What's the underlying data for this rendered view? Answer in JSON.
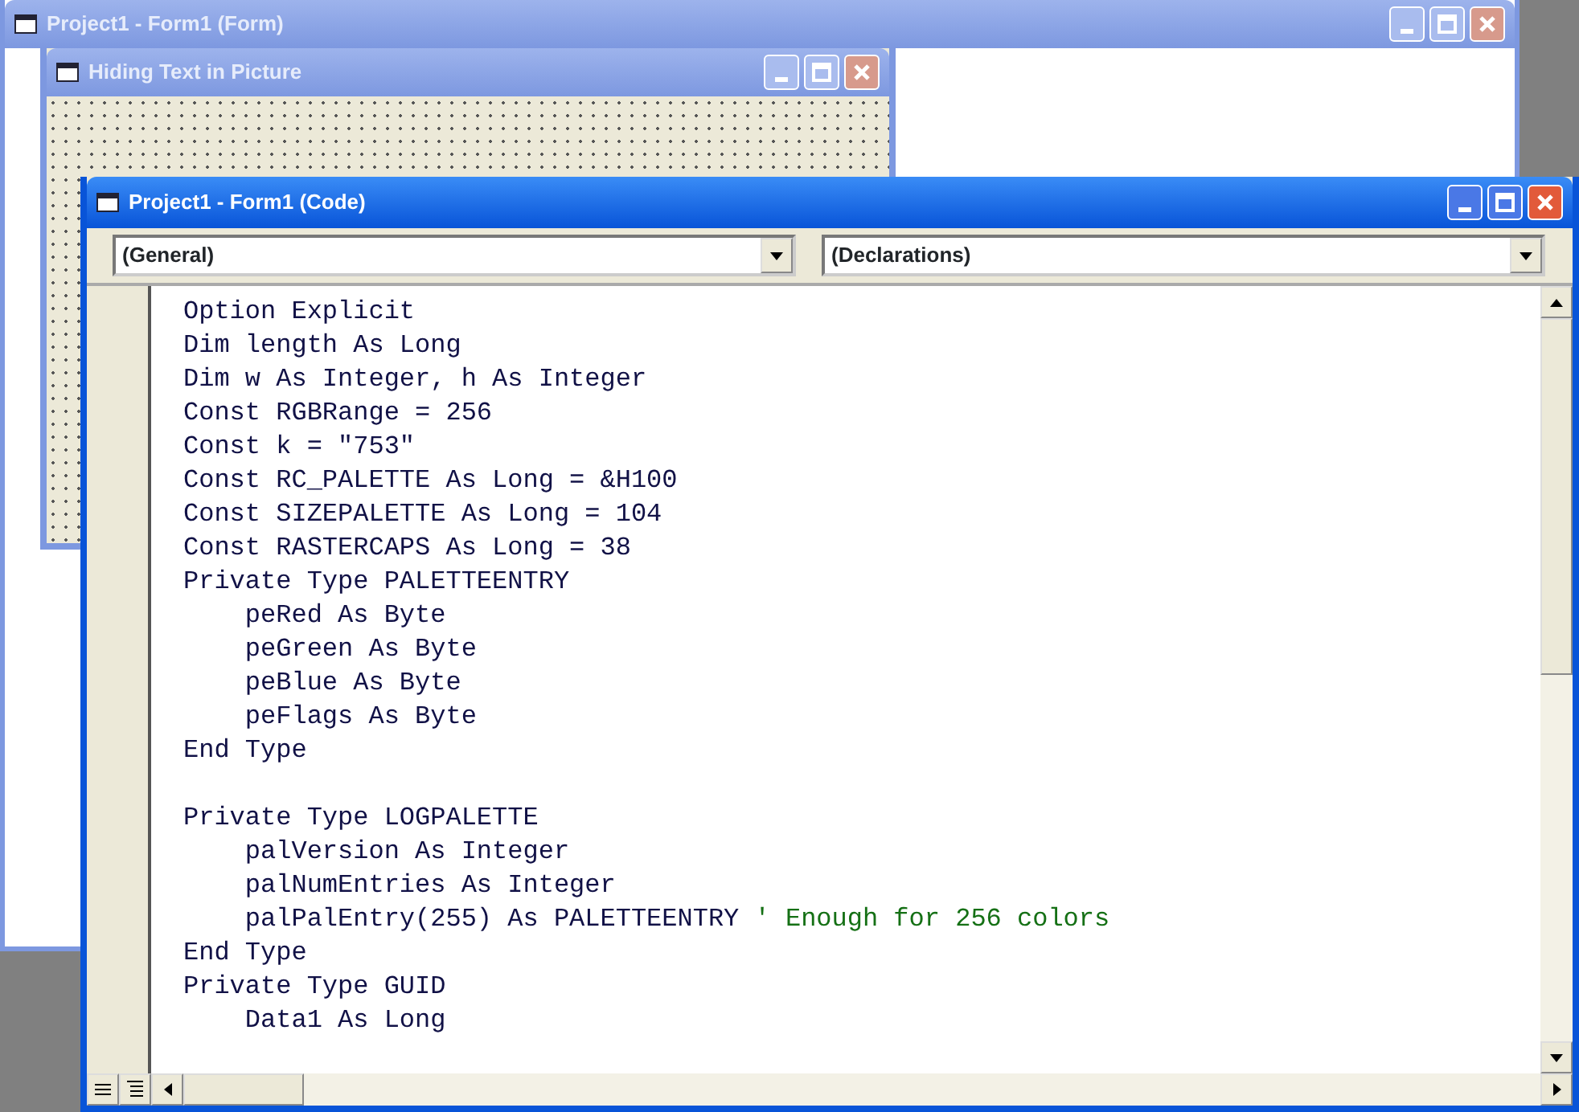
{
  "form_window": {
    "title": "Project1 - Form1 (Form)"
  },
  "designer_window": {
    "title": "Hiding Text in Picture"
  },
  "code_window": {
    "title": "Project1 - Form1 (Code)",
    "object_combo": {
      "value": "(General)"
    },
    "procedure_combo": {
      "value": "(Declarations)"
    },
    "lines": [
      {
        "kind": "code",
        "code": "Option Explicit"
      },
      {
        "kind": "code",
        "code": "Dim length As Long"
      },
      {
        "kind": "code",
        "code": "Dim w As Integer, h As Integer"
      },
      {
        "kind": "code",
        "code": "Const RGBRange = 256"
      },
      {
        "kind": "code",
        "code": "Const k = \"753\""
      },
      {
        "kind": "code",
        "code": "Const RC_PALETTE As Long = &H100"
      },
      {
        "kind": "code",
        "code": "Const SIZEPALETTE As Long = 104"
      },
      {
        "kind": "code",
        "code": "Const RASTERCAPS As Long = 38"
      },
      {
        "kind": "code",
        "code": "Private Type PALETTEENTRY"
      },
      {
        "kind": "code",
        "code": "    peRed As Byte"
      },
      {
        "kind": "code",
        "code": "    peGreen As Byte"
      },
      {
        "kind": "code",
        "code": "    peBlue As Byte"
      },
      {
        "kind": "code",
        "code": "    peFlags As Byte"
      },
      {
        "kind": "code",
        "code": "End Type"
      },
      {
        "kind": "blank"
      },
      {
        "kind": "code",
        "code": "Private Type LOGPALETTE"
      },
      {
        "kind": "code",
        "code": "    palVersion As Integer"
      },
      {
        "kind": "code",
        "code": "    palNumEntries As Integer"
      },
      {
        "kind": "code",
        "code": "    palPalEntry(255) As PALETTEENTRY",
        "comment": "' Enough for 256 colors"
      },
      {
        "kind": "code",
        "code": "End Type"
      },
      {
        "kind": "code",
        "code": "Private Type GUID"
      },
      {
        "kind": "code",
        "code": "    Data1 As Long"
      }
    ]
  }
}
